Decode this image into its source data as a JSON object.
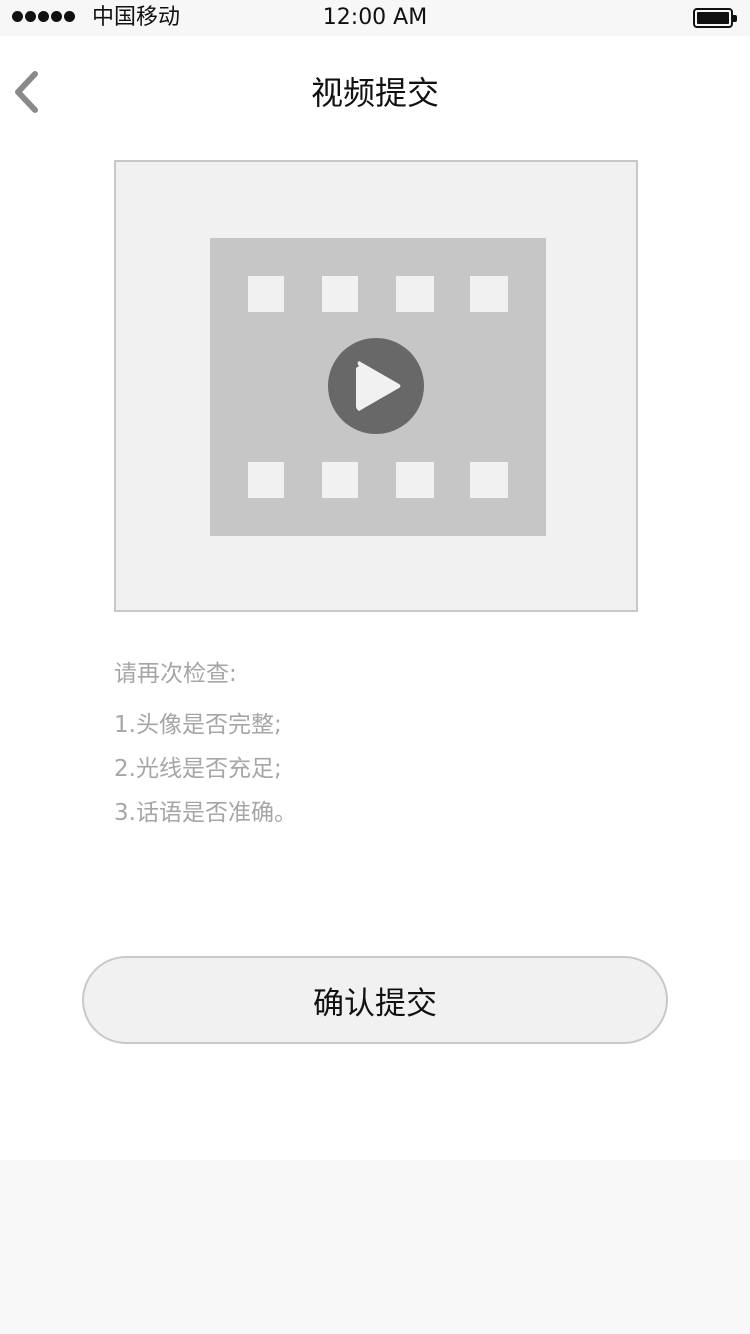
{
  "status_bar": {
    "carrier": "中国移动",
    "time": "12:00 AM",
    "signal_bars": 5,
    "battery_level": 1.0
  },
  "nav": {
    "title": "视频提交",
    "back_icon": "chevron-left-icon"
  },
  "video": {
    "icon": "film-play-icon",
    "colors": {
      "film": "#c6c6c6",
      "play_circle": "#686868",
      "play_arrow": "#f1f1f1"
    }
  },
  "instructions": {
    "heading": "请再次检查:",
    "items": [
      "1.头像是否完整;",
      "2.光线是否充足;",
      "3.话语是否准确。"
    ]
  },
  "actions": {
    "confirm_label": "确认提交"
  }
}
